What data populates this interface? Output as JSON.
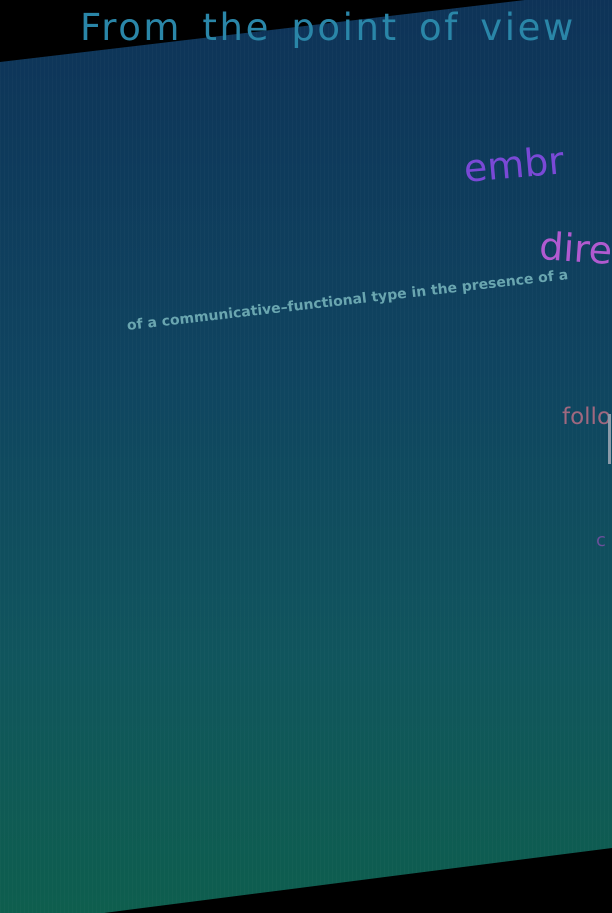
{
  "document": {
    "headline": "From the point of view",
    "fragments": {
      "embr": "embr",
      "dire": "dire",
      "follo": "follo",
      "c": "c"
    },
    "body_line": "of a communicative–functional type in the presence of a"
  },
  "colors": {
    "background": "#000000",
    "panel_top": "#0e3358",
    "panel_bottom": "#0e5e4e",
    "headline": "#2a86a8",
    "embr": "#7a49d6",
    "dire": "#b15ad0",
    "follo": "#a0687f",
    "body_line": "#6aa6b0"
  }
}
